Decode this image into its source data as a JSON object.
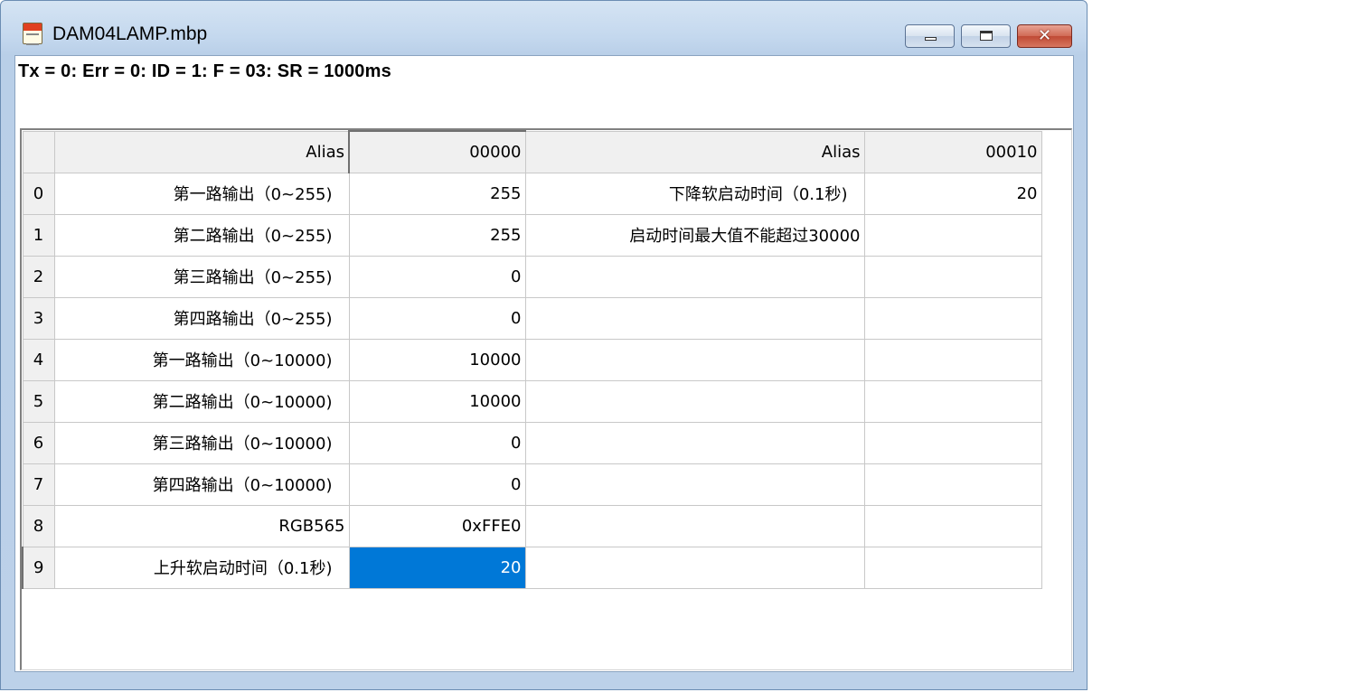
{
  "window": {
    "title": "DAM04LAMP.mbp",
    "icon": "doc-icon",
    "controls": [
      "minimize-icon",
      "maximize-icon",
      "close-icon"
    ]
  },
  "status_line": "Tx = 0: Err = 0: ID = 1: F = 03: SR = 1000ms",
  "grid": {
    "columns": [
      {
        "label": "Alias"
      },
      {
        "label": "00000"
      },
      {
        "label": "Alias"
      },
      {
        "label": "00010"
      }
    ],
    "rows": [
      {
        "index": "0",
        "alias1": "第一路输出（0~255)",
        "val1": "255",
        "alias2": "下降软启动时间（0.1秒)",
        "val2": "20"
      },
      {
        "index": "1",
        "alias1": "第二路输出（0~255)",
        "val1": "255",
        "alias2": "启动时间最大值不能超过30000",
        "val2": ""
      },
      {
        "index": "2",
        "alias1": "第三路输出（0~255)",
        "val1": "0",
        "alias2": "",
        "val2": ""
      },
      {
        "index": "3",
        "alias1": "第四路输出（0~255)",
        "val1": "0",
        "alias2": "",
        "val2": ""
      },
      {
        "index": "4",
        "alias1": "第一路输出（0~10000)",
        "val1": "10000",
        "alias2": "",
        "val2": ""
      },
      {
        "index": "5",
        "alias1": "第二路输出（0~10000)",
        "val1": "10000",
        "alias2": "",
        "val2": ""
      },
      {
        "index": "6",
        "alias1": "第三路输出（0~10000)",
        "val1": "0",
        "alias2": "",
        "val2": ""
      },
      {
        "index": "7",
        "alias1": "第四路输出（0~10000)",
        "val1": "0",
        "alias2": "",
        "val2": ""
      },
      {
        "index": "8",
        "alias1": "RGB565",
        "val1": "0xFFE0",
        "alias2": "",
        "val2": ""
      },
      {
        "index": "9",
        "alias1": "上升软启动时间（0.1秒)",
        "val1": "20",
        "alias2": "",
        "val2": ""
      }
    ],
    "selected_cell": {
      "row": "9",
      "column": "00000"
    },
    "selection_color": "#0078d7"
  }
}
